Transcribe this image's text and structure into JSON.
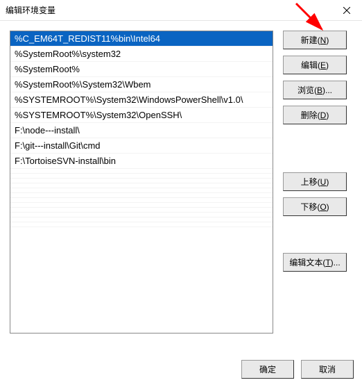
{
  "title": "编辑环境变量",
  "items": [
    "%C_EM64T_REDIST11%bin\\Intel64",
    "%SystemRoot%\\system32",
    "%SystemRoot%",
    "%SystemRoot%\\System32\\Wbem",
    "%SYSTEMROOT%\\System32\\WindowsPowerShell\\v1.0\\",
    "%SYSTEMROOT%\\System32\\OpenSSH\\",
    "F:\\node---install\\",
    "F:\\git---install\\Git\\cmd",
    "F:\\TortoiseSVN-install\\bin"
  ],
  "selected_index": 0,
  "buttons": {
    "new": {
      "label": "新建",
      "mn": "N"
    },
    "edit": {
      "label": "编辑",
      "mn": "E"
    },
    "browse": {
      "label": "浏览",
      "mn": "B",
      "suffix": "..."
    },
    "delete": {
      "label": "删除",
      "mn": "D"
    },
    "moveup": {
      "label": "上移",
      "mn": "U"
    },
    "movedown": {
      "label": "下移",
      "mn": "O"
    },
    "edittext": {
      "label": "编辑文本",
      "mn": "T",
      "suffix": "..."
    }
  },
  "footer": {
    "ok": "确定",
    "cancel": "取消"
  }
}
